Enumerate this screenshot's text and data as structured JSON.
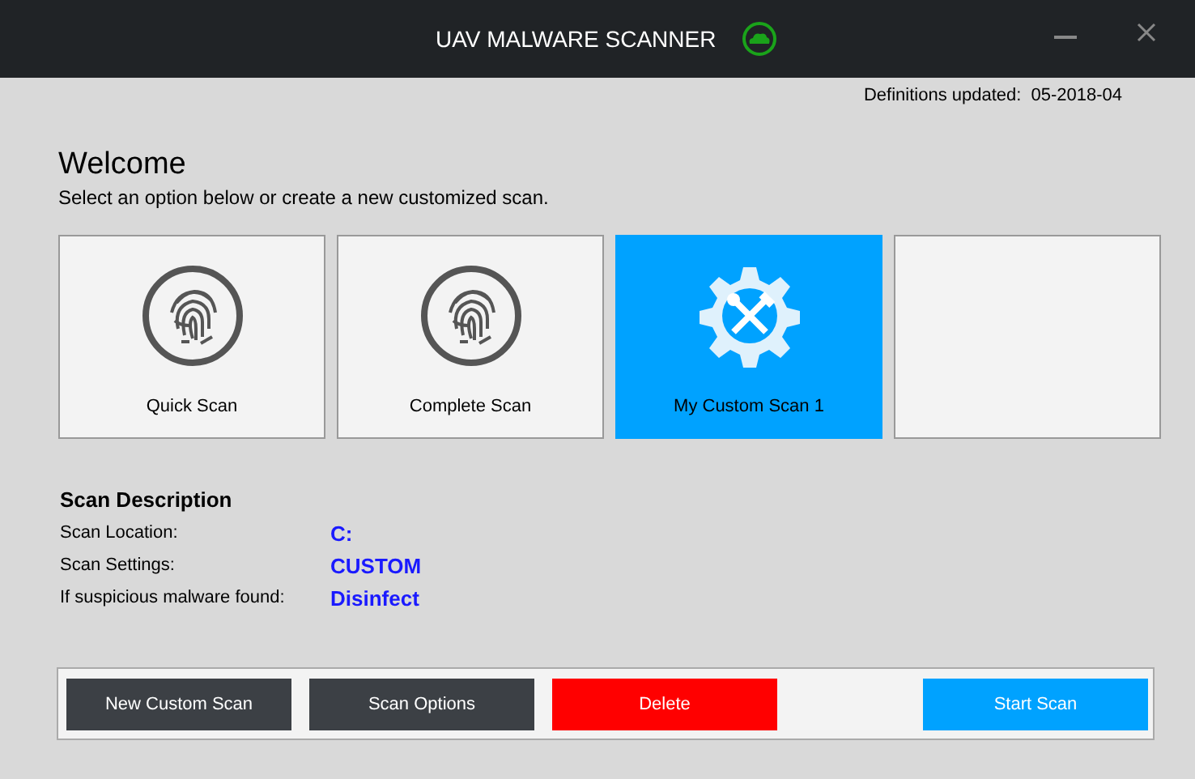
{
  "window": {
    "title": "UAV MALWARE SCANNER"
  },
  "definitions": {
    "label": "Definitions updated:",
    "value": "05-2018-04"
  },
  "heading": "Welcome",
  "subtitle": "Select an option below or create a new customized scan.",
  "tiles": [
    {
      "kind": "fingerprint",
      "label": "Quick Scan",
      "selected": false
    },
    {
      "kind": "fingerprint",
      "label": "Complete Scan",
      "selected": false
    },
    {
      "kind": "gear",
      "label": "My Custom Scan 1",
      "selected": true
    },
    {
      "kind": "empty",
      "selected": false
    }
  ],
  "description": {
    "title": "Scan Description",
    "rows": [
      {
        "label": "Scan Location:",
        "value": "C:"
      },
      {
        "label": "Scan Settings:",
        "value": "CUSTOM"
      },
      {
        "label": "If suspicious malware found:",
        "value": "Disinfect"
      }
    ]
  },
  "buttons": [
    {
      "label": "New Custom Scan",
      "color": "#3c4045"
    },
    {
      "label": "Scan Options",
      "color": "#3c4045"
    },
    {
      "label": "Delete",
      "color": "#ff0000"
    },
    {
      "kind": "spacer"
    },
    {
      "label": "Start Scan",
      "color": "#00a2ff"
    }
  ]
}
